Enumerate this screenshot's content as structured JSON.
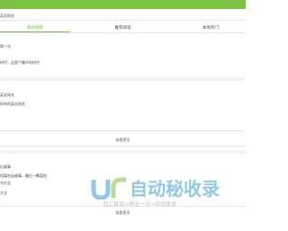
{
  "site": {
    "name": "英文网名"
  },
  "tabs": [
    {
      "label": "最新推荐",
      "active": true
    },
    {
      "label": "推荐阅读",
      "active": false
    },
    {
      "label": "本周热门",
      "active": false
    }
  ],
  "section1": {
    "items": [
      "第一次",
      "时代，这是个最坏的时代"
    ]
  },
  "section2": {
    "items": [
      "英文网名",
      "好听的英文网名"
    ],
    "more_label": "查看更多"
  },
  "section3": {
    "items": [
      "后故事",
      "短篇利益故事，最后一颗荔枝",
      "书大全",
      "大全"
    ],
    "more_label": "查看更多"
  },
  "watermark": {
    "title": "自动秘收录",
    "subtitle": "加上链接→来访一次→自动收录",
    "colors": {
      "title": "#3a9bd8",
      "accent": "#7dc242"
    }
  },
  "colors": {
    "brand": "#7dc242"
  }
}
